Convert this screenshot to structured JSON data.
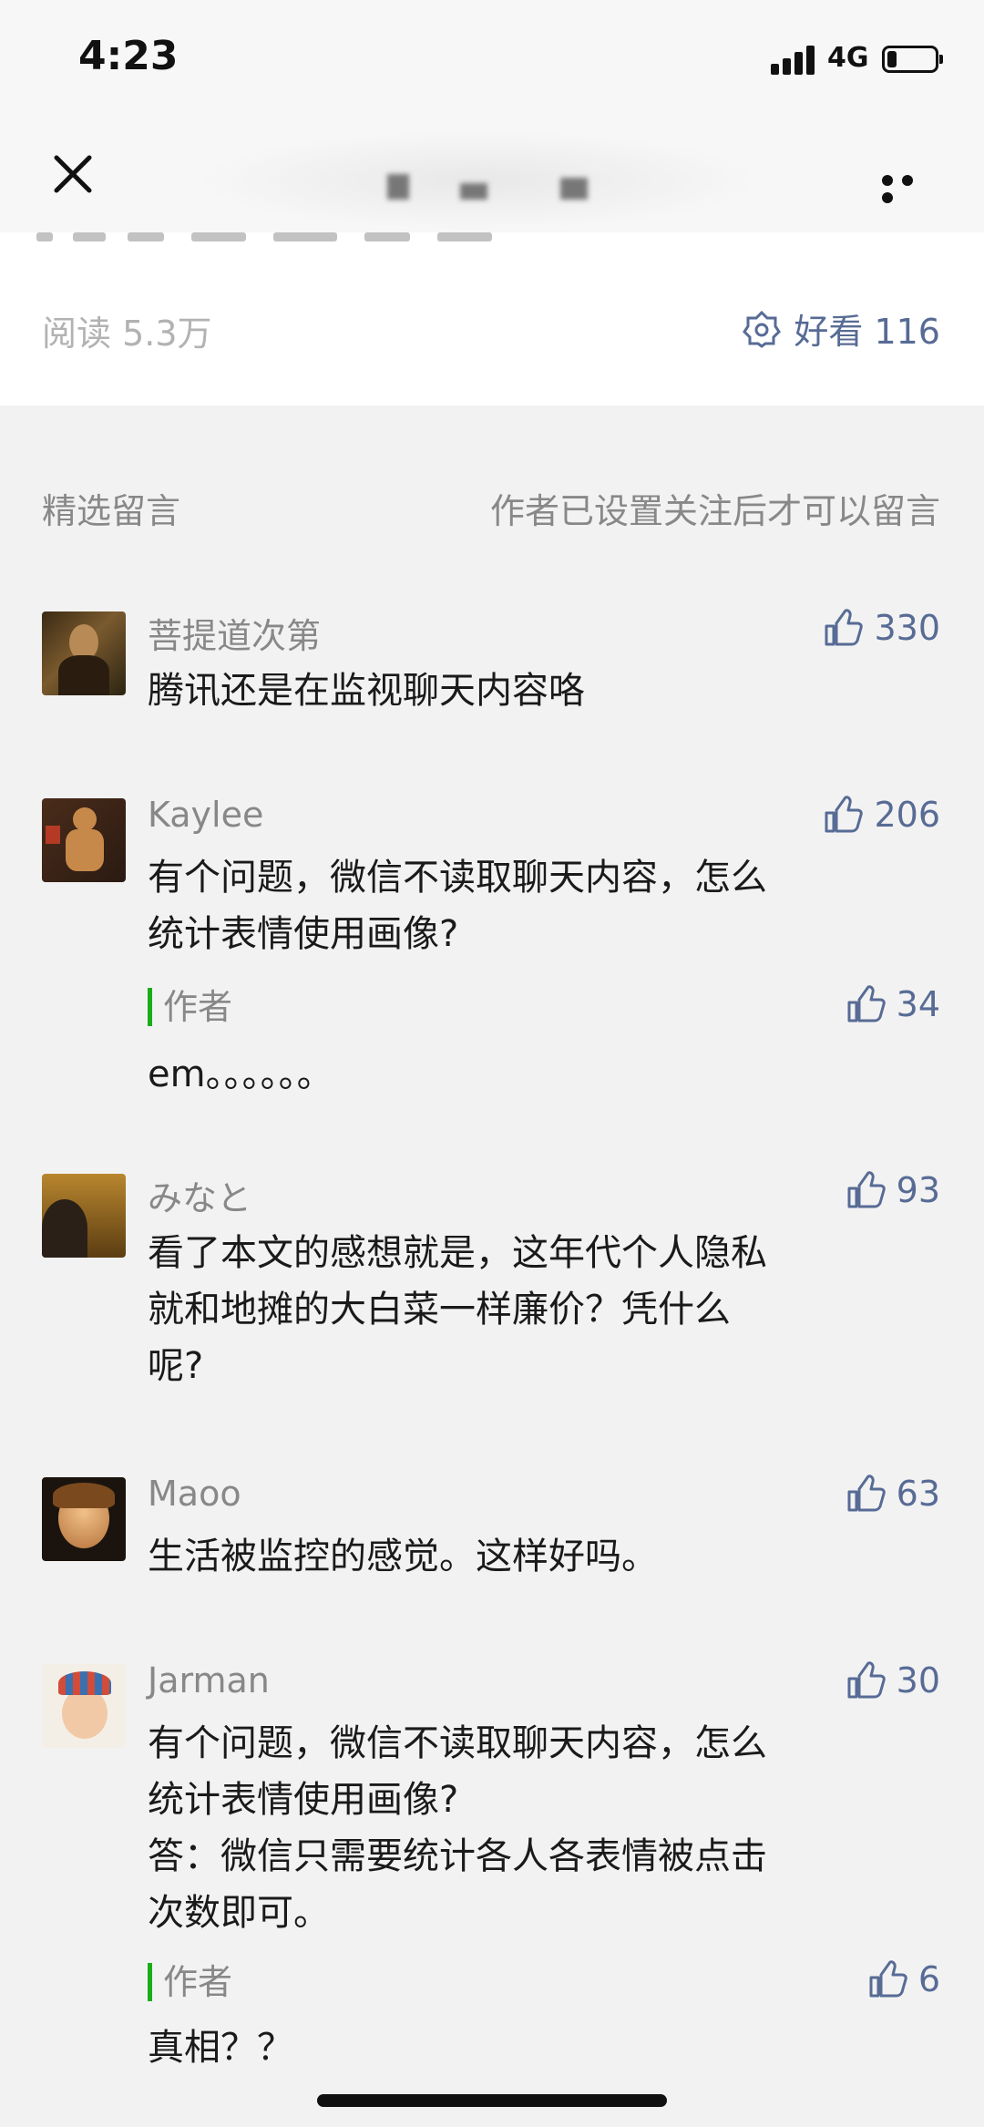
{
  "status_bar": {
    "time": "4:23",
    "network": "4G"
  },
  "article_footer": {
    "read_count": "阅读 5.3万",
    "wow_label": "好看 116"
  },
  "comments_section": {
    "title": "精选留言",
    "note": "作者已设置关注后才可以留言"
  },
  "comments": [
    {
      "nickname": "菩提道次第",
      "likes": "330",
      "text": [
        "腾讯还是在监视聊天内容咯"
      ]
    },
    {
      "nickname": "Kaylee",
      "likes": "206",
      "text": [
        "有个问题，微信不读取聊天内容，怎么",
        "统计表情使用画像?"
      ],
      "reply": {
        "tag": "作者",
        "likes": "34",
        "text": "em。。。。。。"
      }
    },
    {
      "nickname": "みなと",
      "likes": "93",
      "text": [
        "看了本文的感想就是，这年代个人隐私",
        "就和地摊的大白菜一样廉价？凭什么",
        "呢?"
      ]
    },
    {
      "nickname": "Maoo",
      "likes": "63",
      "text": [
        "生活被监控的感觉。这样好吗。"
      ]
    },
    {
      "nickname": "Jarman",
      "likes": "30",
      "text": [
        "有个问题，微信不读取聊天内容，怎么",
        "统计表情使用画像?",
        "答：微信只需要统计各人各表情被点击",
        "次数即可。"
      ],
      "reply": {
        "tag": "作者",
        "likes": "6",
        "text": "真相？？"
      }
    }
  ],
  "icons": {
    "close": "close-icon",
    "more": "more-icon",
    "wow": "wow-flower-icon",
    "like": "thumbs-up-icon"
  },
  "colors": {
    "link": "#576b95",
    "author_bar": "#1aad19",
    "muted": "#888888"
  }
}
